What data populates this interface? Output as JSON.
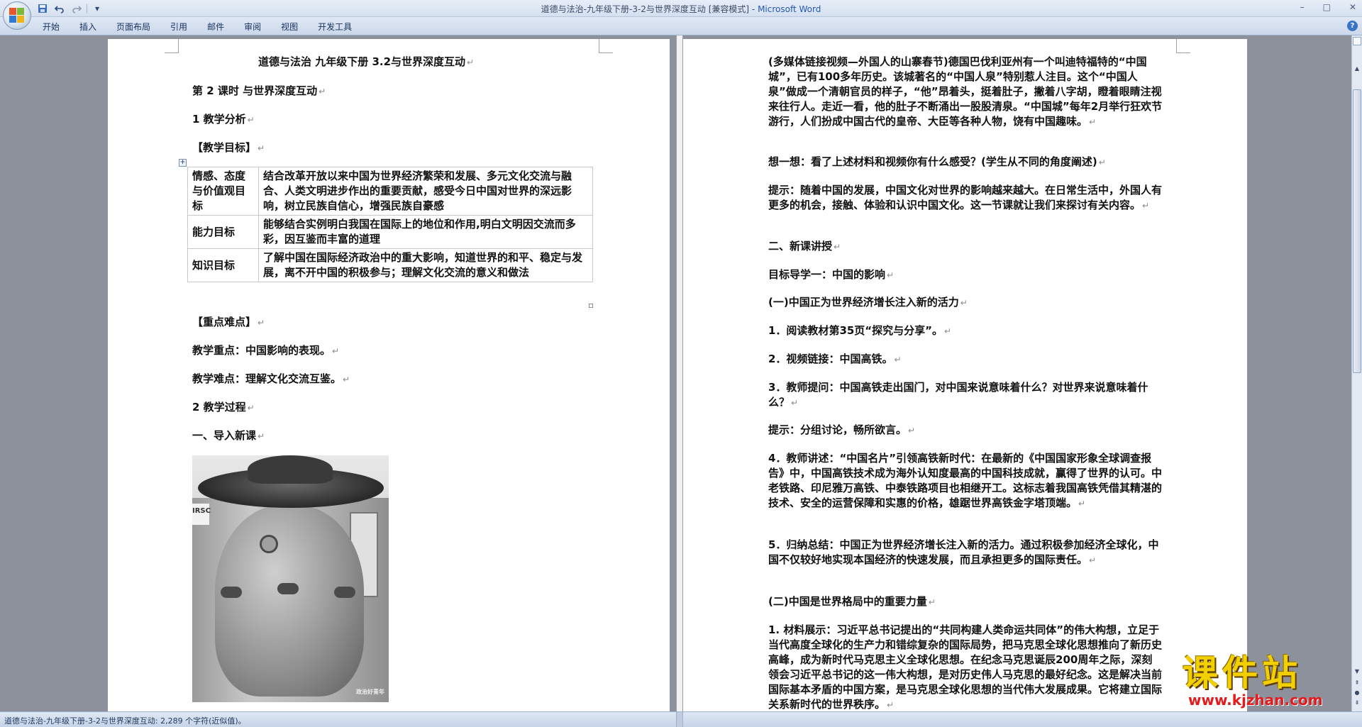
{
  "window": {
    "title_doc": "道德与法治-九年级下册-3-2与世界深度互动 [兼容模式] - ",
    "title_app": "Microsoft Word",
    "qat": {
      "save_icon": "save-icon",
      "undo_icon": "undo-icon",
      "redo_icon": "redo-icon",
      "customize_icon": "chevron-down-icon"
    },
    "controls": {
      "minimize": "–",
      "maximize": "□",
      "close": "✕"
    }
  },
  "ribbon": {
    "tabs": [
      "开始",
      "插入",
      "页面布局",
      "引用",
      "邮件",
      "审阅",
      "视图",
      "开发工具"
    ],
    "help": "?"
  },
  "left_page": {
    "title": "道德与法治  九年级下册  3.2与世界深度互动",
    "lesson": "第 2 课时   与世界深度互动",
    "section1": "1    教学分析",
    "objectives_heading": "【教学目标】",
    "objectives": [
      {
        "label": "情感、态度与价值观目标",
        "text": "结合改革开放以来中国为世界经济繁荣和发展、多元文化交流与融合、人类文明进步作出的重要贡献，感受今日中国对世界的深远影响，树立民族自信心，增强民族自豪感"
      },
      {
        "label": "能力目标",
        "text": "能够结合实例明白我国在国际上的地位和作用,明白文明因交流而多彩，因互鉴而丰富的道理"
      },
      {
        "label": "知识目标",
        "text": "了解中国在国际经济政治中的重大影响，知道世界的和平、稳定与发展，离不开中国的积极参与；理解文化交流的意义和做法"
      }
    ],
    "key_heading": "【重点难点】",
    "key_point": "教学重点：中国影响的表现。",
    "difficulty": "教学难点：理解文化交流互鉴。",
    "section2": "2    教学过程",
    "intro": "一、导入新课",
    "photo_sign": "IRSC",
    "photo_watermark": "政治好青年"
  },
  "right_page": {
    "paragraphs": [
      "(多媒体链接视频—外国人的山寨春节)德国巴伐利亚州有一个叫迪特福特的“中国城”，已有100多年历史。该城著名的“中国人泉”特别惹人注目。这个“中国人泉”做成一个清朝官员的样子，“他”昂着头，挺着肚子，撇着八字胡，瞪着眼睛注视来往行人。走近一看，他的肚子不断涌出一股股清泉。“中国城”每年2月举行狂欢节游行，人们扮成中国古代的皇帝、大臣等各种人物，饶有中国趣味。",
      "想一想：看了上述材料和视频你有什么感受？(学生从不同的角度阐述)",
      "提示：随着中国的发展，中国文化对世界的影响越来越大。在日常生活中，外国人有更多的机会，接触、体验和认识中国文化。这一节课就让我们来探讨有关内容。",
      "二、新课讲授",
      "目标导学一：中国的影响",
      "(一)中国正为世界经济增长注入新的活力",
      "1．阅读教材第35页“探究与分享”。",
      "2．视频链接：中国高铁。",
      "3．教师提问：中国高铁走出国门，对中国来说意味着什么？对世界来说意味着什么？",
      "提示：分组讨论，畅所欲言。",
      "4．教师讲述：“中国名片”引领高铁新时代：在最新的《中国国家形象全球调查报告》中，中国高铁技术成为海外认知度最高的中国科技成就，赢得了世界的认可。中老铁路、印尼雅万高铁、中泰铁路项目也相继开工。这标志着我国高铁凭借其精湛的技术、安全的运营保障和实惠的价格，雄踞世界高铁金字塔顶端。",
      "5．归纳总结：中国正为世界经济增长注入新的活力。通过积极参加经济全球化，中国不仅较好地实现本国经济的快速发展，而且承担更多的国际责任。",
      "(二)中国是世界格局中的重要力量",
      "1. 材料展示：习近平总书记提出的“共同构建人类命运共同体”的伟大构想，立足于当代高度全球化的生产力和错综复杂的国际局势，把马克思全球化思想推向了新历史高峰，成为新时代马克思主义全球化思想。在纪念马克思诞辰200周年之际，深刻领会习近平总书记的这一伟大构想，是对历史伟人马克思的最好纪念。这是解决当前国际基本矛盾的中国方案，是马克思全球化思想的当代伟大发展成果。它将建立国际关系新时代的世界秩序。"
    ]
  },
  "status": {
    "text": "道德与法治-九年级下册-3-2与世界深度互动: 2,289 个字符(近似值)。"
  },
  "watermark": {
    "cn": "课件站",
    "url": "www.kjzhan.com"
  }
}
